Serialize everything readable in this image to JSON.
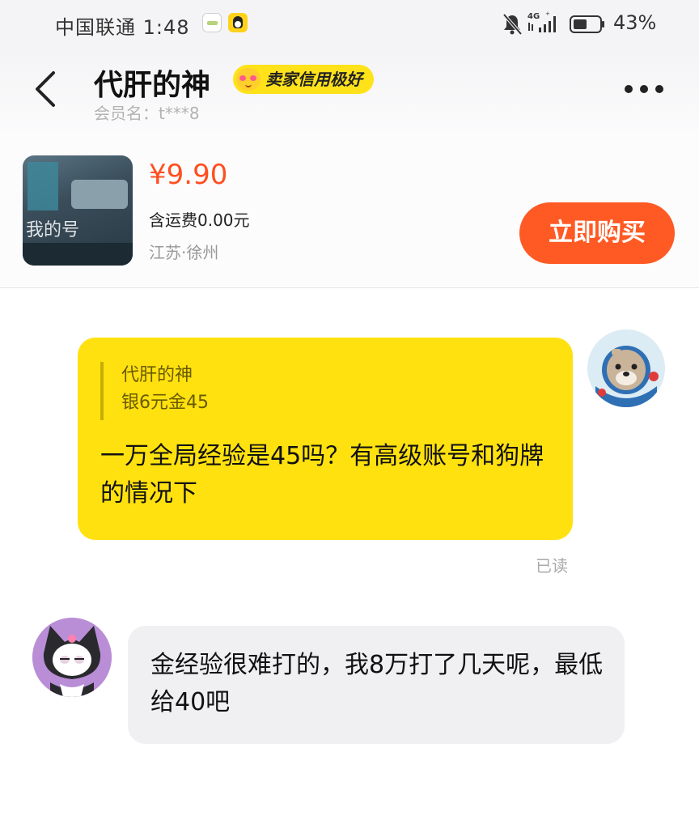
{
  "status_bar": {
    "carrier_time": "中国联通 1:48",
    "network": "4G",
    "battery": "43%"
  },
  "header": {
    "title": "代肝的神",
    "badge": "卖家信用极好",
    "member": "会员名：t***8",
    "icons": {
      "back": "back-chevron-icon",
      "more": "more-dots-icon"
    }
  },
  "product": {
    "price": "¥9.90",
    "shipping": "含运费0.00元",
    "location": "江苏·徐州",
    "buy_label": "立即购买",
    "thumb_text": "我的号",
    "accent_color": "#ff5a23",
    "price_color": "#ff4e1f"
  },
  "chat": {
    "outgoing": {
      "quote_name": "代肝的神",
      "quote_text": "银6元金45",
      "text": "一万全局经验是45吗？有高级账号和狗牌的情况下",
      "status": "已读",
      "bubble_color": "#ffe10f"
    },
    "incoming": {
      "text": "金经验很难打的，我8万打了几天呢，最低给40吧",
      "bubble_color": "#f0f0f2"
    }
  }
}
